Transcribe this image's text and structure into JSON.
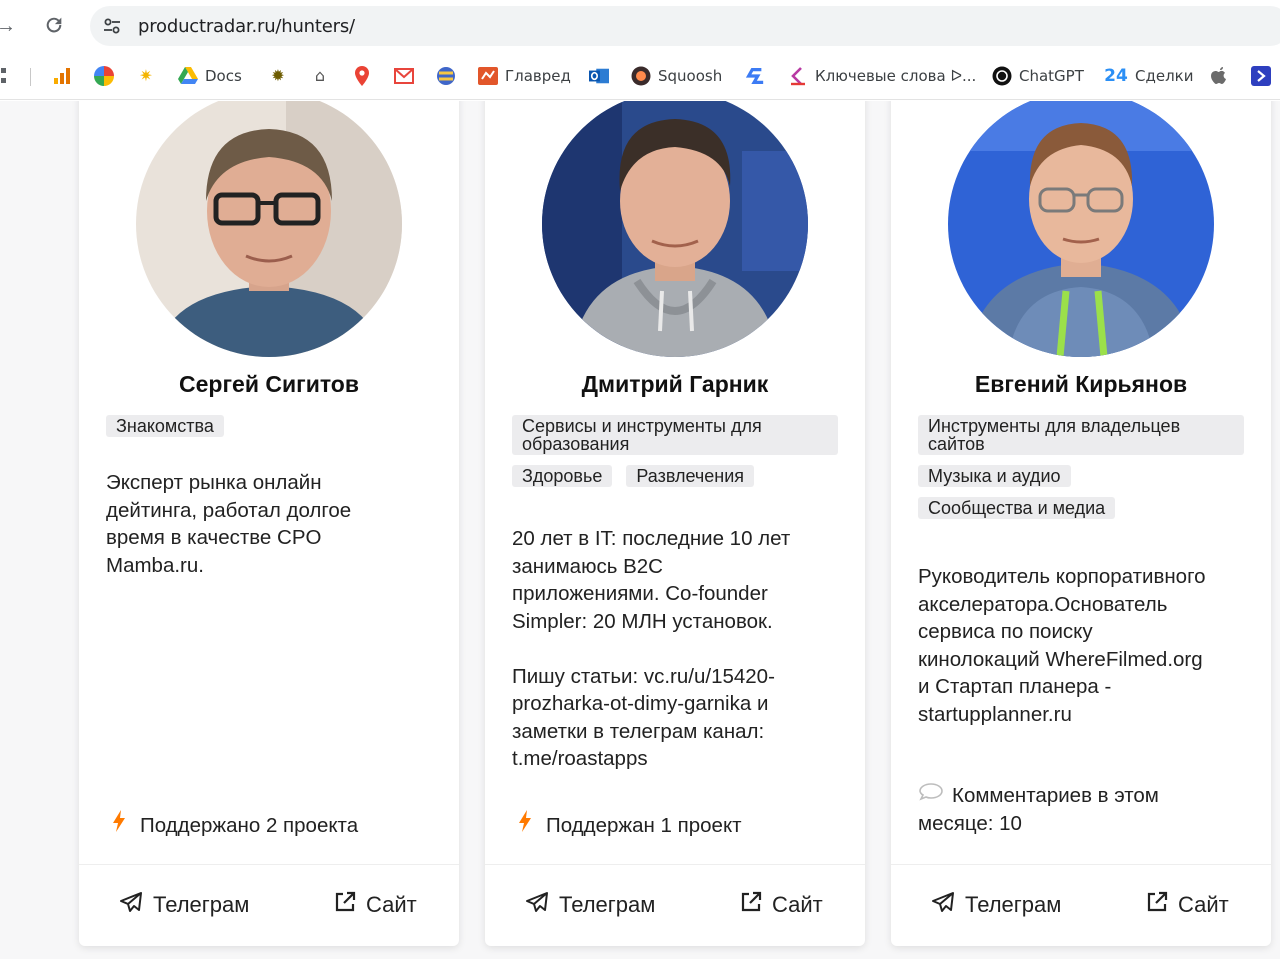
{
  "browser": {
    "url": "productradar.ru/hunters/",
    "bookmarks": [
      {
        "icon": "grid-icon",
        "label": ""
      },
      {
        "icon": "analytics-icon",
        "label": ""
      },
      {
        "icon": "color-wheel-icon",
        "label": ""
      },
      {
        "icon": "sun-icon",
        "label": ""
      },
      {
        "icon": "google-drive-icon",
        "label": "Docs"
      },
      {
        "icon": "bug-icon",
        "label": ""
      },
      {
        "icon": "incognito-icon",
        "label": ""
      },
      {
        "icon": "map-pin-icon",
        "label": ""
      },
      {
        "icon": "mail-icon",
        "label": ""
      },
      {
        "icon": "globe-icon",
        "label": ""
      },
      {
        "icon": "glavred-icon",
        "label": "Главред"
      },
      {
        "icon": "outlook-icon",
        "label": ""
      },
      {
        "icon": "squoosh-icon",
        "label": "Squoosh"
      },
      {
        "icon": "s-logo-icon",
        "label": ""
      },
      {
        "icon": "keywords-icon",
        "label": "Ключевые слова ᐅ..."
      },
      {
        "icon": "chatgpt-icon",
        "label": "ChatGPT"
      },
      {
        "icon": "bitrix24-icon",
        "label": "Сделки"
      },
      {
        "icon": "apple-icon",
        "label": ""
      },
      {
        "icon": "arrow-badge-icon",
        "label": ""
      }
    ]
  },
  "hunters": [
    {
      "name": "Сергей Сигитов",
      "tags": [
        "Знакомства"
      ],
      "bio": "Эксперт рынка онлайн\nдейтинга, работал долгое\nвремя в качестве CPO\nMamba.ru.",
      "stat": "Поддержано 2 проекта",
      "stat_icon": "lightning-icon",
      "telegram_label": "Телеграм",
      "site_label": "Сайт"
    },
    {
      "name": "Дмитрий Гарник",
      "tags": [
        "Сервисы и инструменты для образования",
        "Здоровье",
        "Развлечения"
      ],
      "bio": "20 лет в IT: последние 10 лет\nзанимаюсь B2C\nприложениями. Co-founder\nSimpler: 20 МЛН установок.\n\nПишу статьи: vc.ru/u/15420-\nprozharka-ot-dimy-garnika и\nзаметки в телеграм канал:\nt.me/roastapps",
      "stat": "Поддержан 1 проект",
      "stat_icon": "lightning-icon",
      "telegram_label": "Телеграм",
      "site_label": "Сайт"
    },
    {
      "name": "Евгений Кирьянов",
      "tags": [
        "Инструменты для владельцев сайтов",
        "Музыка и аудио",
        "Сообщества и медиа"
      ],
      "bio": "Руководитель корпоративного\nакселератора.Основатель\nсервиса по поиску\nкинолокаций WhereFilmed.org\nи Стартап планера -\nstartupplanner.ru",
      "stat": "Комментариев в этом месяце: 10",
      "stat_icon": "comment-icon",
      "telegram_label": "Телеграм",
      "site_label": "Сайт"
    }
  ],
  "colors": {
    "accent_orange": "#ff7a00",
    "tag_bg": "#ececee"
  }
}
